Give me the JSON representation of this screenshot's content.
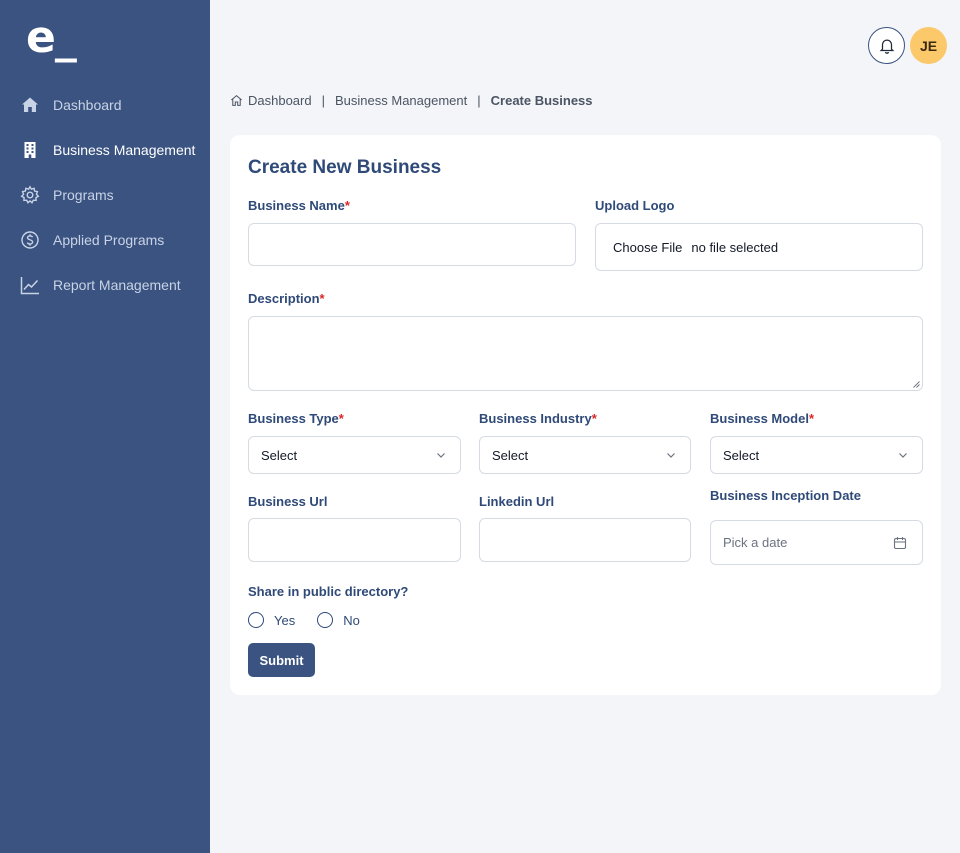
{
  "sidebar": {
    "logo": "e_",
    "items": [
      {
        "label": "Dashboard",
        "icon": "home-icon"
      },
      {
        "label": "Business Management",
        "icon": "building-icon",
        "active": true
      },
      {
        "label": "Programs",
        "icon": "gear-icon"
      },
      {
        "label": "Applied Programs",
        "icon": "dollar-circle-icon"
      },
      {
        "label": "Report Management",
        "icon": "chart-line-icon"
      }
    ]
  },
  "header": {
    "avatar_initials": "JE",
    "bell_icon": "bell-icon"
  },
  "breadcrumb": {
    "items": [
      "Dashboard",
      "Business Management",
      "Create Business"
    ],
    "separator": "|"
  },
  "form": {
    "title": "Create New Business",
    "required_marker": "*",
    "business_name": {
      "label": "Business Name",
      "value": ""
    },
    "upload_logo": {
      "label": "Upload Logo",
      "button": "Choose File",
      "status": "no file selected"
    },
    "description": {
      "label": "Description",
      "value": ""
    },
    "business_type": {
      "label": "Business Type",
      "value": "Select"
    },
    "business_industry": {
      "label": "Business Industry",
      "value": "Select"
    },
    "business_model": {
      "label": "Business Model",
      "value": "Select"
    },
    "business_url": {
      "label": "Business Url",
      "value": ""
    },
    "linkedin_url": {
      "label": "Linkedin Url",
      "value": ""
    },
    "inception_date": {
      "label": "Business Inception Date",
      "placeholder": "Pick a date"
    },
    "public_directory": {
      "label": "Share in public directory?",
      "options": [
        "Yes",
        "No"
      ]
    },
    "submit_label": "Submit"
  },
  "colors": {
    "sidebar_bg": "#3a5380",
    "accent": "#2f4a78",
    "required": "#dc2626",
    "avatar_bg": "#fbc86a",
    "page_bg": "#f3f5f9"
  }
}
